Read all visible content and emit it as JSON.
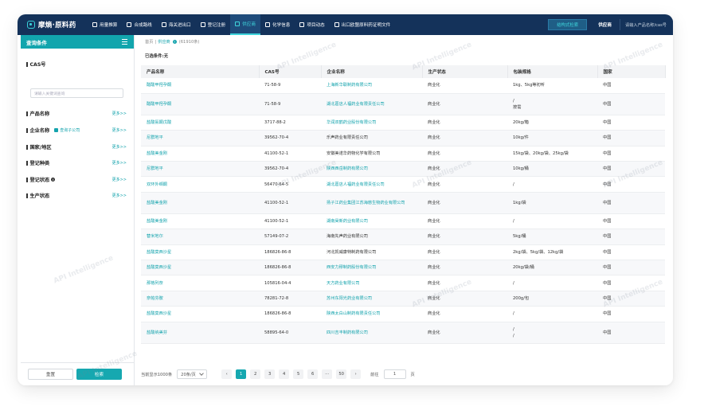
{
  "app": {
    "logo_text": "摩熵·原料药"
  },
  "nav": {
    "items": [
      {
        "label": "用量推算",
        "icon": "chart-icon"
      },
      {
        "label": "合成路线",
        "icon": "route-icon"
      },
      {
        "label": "海关进出口",
        "icon": "customs-icon"
      },
      {
        "label": "登记注册",
        "icon": "register-icon"
      },
      {
        "label": "供应商",
        "icon": "supplier-icon"
      },
      {
        "label": "化学信息",
        "icon": "chemistry-icon"
      },
      {
        "label": "项目动态",
        "icon": "project-icon"
      },
      {
        "label": "出口欧盟原料药证明文件",
        "icon": "document-icon"
      }
    ],
    "active_index": 4,
    "struct_search_label": "结构式检索",
    "scope_label": "供应商",
    "search_placeholder": "请输入产品名称/cas号"
  },
  "sidebar": {
    "title": "查询条件",
    "cas_label": "CAS号",
    "cas_placeholder": "请输入关键词查询",
    "filters": [
      {
        "label": "产品名称",
        "more": "更多>>"
      },
      {
        "label": "企业名称",
        "more": "更多>>",
        "sub_label": "查询子公司"
      },
      {
        "label": "国家/地区",
        "more": "更多>>"
      },
      {
        "label": "登记种类",
        "more": "更多>>"
      },
      {
        "label": "登记状态",
        "more": "更多>>"
      },
      {
        "label": "生产状态",
        "more": "更多>>"
      }
    ],
    "reset_label": "重置",
    "search_label": "检索"
  },
  "breadcrumb": {
    "home": "首页",
    "current": "供应商",
    "count": "(61910条)"
  },
  "selected_conditions": "已选条件:无",
  "table": {
    "headers": [
      "产品名称",
      "CAS号",
      "企业名称",
      "生产状态",
      "包装规格",
      "国家"
    ],
    "rows": [
      {
        "product": "醋酸甲羟孕酮",
        "cas": "71-58-9",
        "company": "上海新华联制药有限公司",
        "status": "商业化",
        "pack": "1kg、5kg等初听",
        "country": "中国"
      },
      {
        "product": "醋酸甲羟孕酮",
        "cas": "71-58-9",
        "company": "湖北葛店人福药业有限责任公司",
        "status": "商业化",
        "pack": "/\n按需",
        "country": "中国"
      },
      {
        "product": "盐酸氨酮戊酸",
        "cas": "3717-88-2",
        "company": "华润双鹤药业股份有限公司",
        "status": "商业化",
        "pack": "20kg/箱",
        "country": "中国"
      },
      {
        "product": "尼群地平",
        "cas": "39562-70-4",
        "company": "乐声药业有限责任公司",
        "status": "商业化",
        "pack": "10kg/件",
        "country": "中国"
      },
      {
        "product": "盐酸美金刚",
        "cas": "41100-52-1",
        "company": "安徽美诺华药物化学有限公司",
        "status": "商业化",
        "pack": "15kg/袋、20kg/袋、25kg/袋",
        "country": "中国"
      },
      {
        "product": "尼群地平",
        "cas": "39562-70-4",
        "company": "陕西西岳制药有限公司",
        "status": "商业化",
        "pack": "10kg/桶",
        "country": "中国"
      },
      {
        "product": "双环外缬酮",
        "cas": "56470-64-5",
        "company": "湖北葛店人福药业有限责任公司",
        "status": "商业化",
        "pack": "/",
        "country": "中国"
      },
      {
        "product": "盐酸美金刚",
        "cas": "41100-52-1",
        "company": "扬子江药业集团江苏海慈生物药业有限公司",
        "status": "商业化",
        "pack": "1kg/袋",
        "country": "中国"
      },
      {
        "product": "盐酸美金刚",
        "cas": "41100-52-1",
        "company": "湖南昊新药业有限公司",
        "status": "商业化",
        "pack": "/",
        "country": "中国"
      },
      {
        "product": "替米地尔",
        "cas": "57149-07-2",
        "company": "海南先声药业有限公司",
        "status": "商业化",
        "pack": "5kg/桶",
        "country": "中国"
      },
      {
        "product": "盐酸莫西沙星",
        "cas": "186826-86-8",
        "company": "河北凯威康特制药有限公司",
        "status": "商业化",
        "pack": "2kg/袋、5kg/袋、12kg/袋",
        "country": "中国"
      },
      {
        "product": "盐酸莫西沙星",
        "cas": "186826-86-8",
        "company": "西安力穆制药股份有限公司",
        "status": "商业化",
        "pack": "20kg/袋/桶",
        "country": "中国"
      },
      {
        "product": "那格列奈",
        "cas": "105816-04-4",
        "company": "天方药业有限公司",
        "status": "商业化",
        "pack": "/",
        "country": "中国"
      },
      {
        "product": "奈帕芬胺",
        "cas": "78281-72-8",
        "company": "苏州东阳光药业有限公司",
        "status": "商业化",
        "pack": "200g/包",
        "country": "中国"
      },
      {
        "product": "盐酸莫西沙星",
        "cas": "186826-86-8",
        "company": "陕西太白山制药有限责任公司",
        "status": "商业化",
        "pack": "/",
        "country": "中国"
      },
      {
        "product": "盐酸纳美芬",
        "cas": "58895-64-0",
        "company": "四川吉丰制药有限公司",
        "status": "商业化",
        "pack": "/\n/",
        "country": "中国"
      }
    ]
  },
  "pagination": {
    "total_text": "当前显示1000条",
    "page_size": "20条/页",
    "pages": [
      "1",
      "2",
      "3",
      "4",
      "5",
      "6",
      "···",
      "50"
    ],
    "active_page": "1",
    "goto_label": "前往",
    "goto_value": "1",
    "page_word": "页"
  },
  "watermark": "API Intelligence"
}
